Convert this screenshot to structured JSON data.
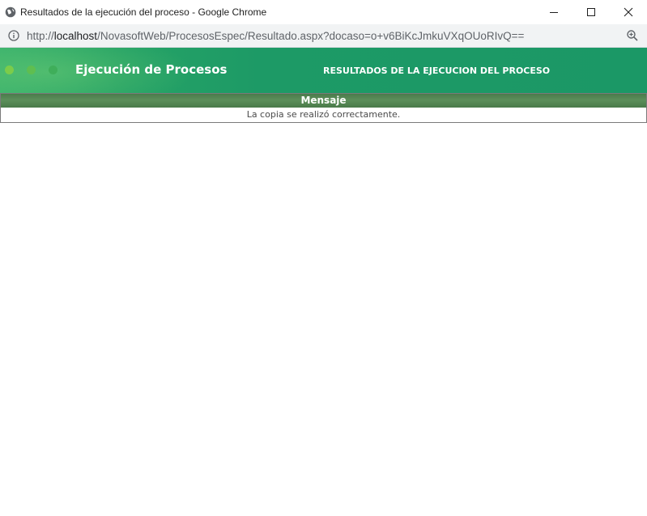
{
  "window": {
    "title": "Resultados de la ejecución del proceso - Google Chrome"
  },
  "address_bar": {
    "url_scheme": "http://",
    "url_host": "localhost",
    "url_path": "/NovasoftWeb/ProcesosEspec/Resultado.aspx?docaso=o+v6BiKcJmkuVXqOUoRIvQ=="
  },
  "header": {
    "title": "Ejecución de Procesos",
    "subtitle": "RESULTADOS DE LA EJECUCION DEL PROCESO"
  },
  "message_table": {
    "column_header": "Mensaje",
    "rows": [
      {
        "text": "La copia se realizó correctamente."
      }
    ]
  },
  "colors": {
    "header_green": "#1d9a66",
    "table_header_green": "#5b8f5a"
  },
  "icons": {
    "app": "globe-icon",
    "info": "info-icon",
    "zoom": "zoom-icon",
    "minimize": "minimize-icon",
    "maximize": "maximize-icon",
    "close": "close-icon"
  }
}
